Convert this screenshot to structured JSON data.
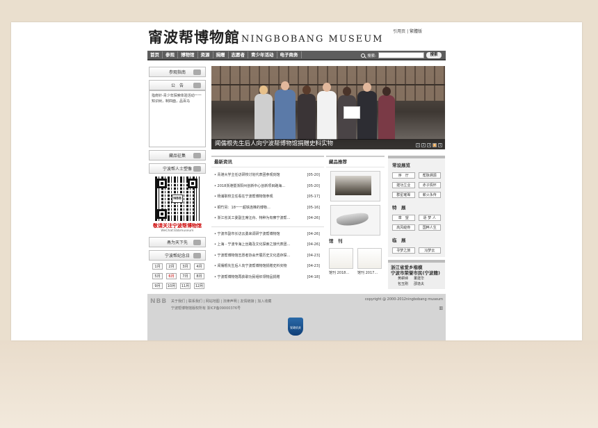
{
  "header": {
    "logo_cn": "甯波帮博物館",
    "logo_en": "NINGBOBANG  MUSEUM",
    "top_links": "引用页 | 繁體版"
  },
  "nav": {
    "items": [
      "首页",
      "参观",
      "博物馆",
      "资源",
      "捐赠",
      "志愿者",
      "青少年活动",
      "电子商务"
    ],
    "search_label": "搜索:",
    "search_button": "搜索"
  },
  "left": {
    "visit_guide": "参观指南",
    "notice_title": "公　告",
    "notice_text": "指南针-青少年探索体验活动一一知识树，制四面，品百马",
    "collect": "藏品征集",
    "portrait": "宁波帮人士塑像",
    "follow": "敬请关注宁波帮博物馆",
    "follow_en": "WeChat:Ebbmuseum",
    "qr_mid": "NBB",
    "world": "甬为天下先",
    "memorial": "宁波帮纪念日",
    "months": [
      "1月",
      "2月",
      "3月",
      "4月",
      "5月",
      "6月",
      "7月",
      "8月",
      "9月",
      "10月",
      "11月",
      "12月"
    ],
    "current_month": "6月"
  },
  "banner": {
    "caption": "闻儒根先生后人向宁波帮博物馆捐赠史料实物",
    "dots": [
      "1",
      "2",
      "3",
      "4",
      "5"
    ]
  },
  "news": {
    "title": "最新资讯",
    "group1": [
      {
        "t": "青港大学主任访研校讨划代表团参观刻馆",
        "d": "[05-20]"
      },
      {
        "t": "2018浙港暨浙阳州创新中心创新项目路海…",
        "d": "[05-20]"
      },
      {
        "t": "杨浦职校主任看在宁波帮博物馆参观",
        "d": "[05-17]"
      },
      {
        "t": "铜竹另：18一一超铁连推的博物…",
        "d": "[05-16]"
      },
      {
        "t": "浙江省关工委副主席汪舟、特种为有察宁波帮…",
        "d": "[04-26]"
      }
    ],
    "group2": [
      {
        "t": "宁波市副市长访云勇来调研宁波帮博物馆",
        "d": "[04-26]"
      },
      {
        "t": "上海 - 宁波专海上丝路及文化探索之旅代表团…",
        "d": "[04-26]"
      },
      {
        "t": "宁波帮博物馆志愿者协会开展历史文化遗存探…",
        "d": "[04-23]"
      },
      {
        "t": "闻儒根先生后人向宁波帮博物馆捐赠史料实物",
        "d": "[04-23]"
      },
      {
        "t": "宁波帮博物馆再获歌功民组织领物品捐赠",
        "d": "[04-18]"
      }
    ]
  },
  "collection": {
    "title": "藏品推荐",
    "journal_title": "馆　刊",
    "journals": [
      "馆刊 2018…",
      "馆刊 2017…"
    ]
  },
  "right": {
    "exhibit_title": "常设展览",
    "exhibits": [
      "序　厅",
      "帮脉溯源",
      "建功立业",
      "赤子情怀",
      "群星璀璨",
      "薪火永传"
    ],
    "special_title": "特　展",
    "specials": [
      "章　望",
      "逐 梦 人",
      "高风峻骨",
      "国粹人生"
    ],
    "temp_title": "临　展",
    "temps": [
      "寻梦之旅",
      "冯梦云"
    ],
    "tag_line1": "浙江省爱乡楷模",
    "tag_line2": "宁波市荣誉市民",
    "tag_paren": "(宁波籍)",
    "tag_sub": [
      "黄耕婶",
      "董建华",
      "包玉刚",
      "邵逸夫"
    ]
  },
  "footer": {
    "logo": "NBB",
    "links": "关于我们 | 联系我们 | 网站地图 | 法律声明 | 友情链接 | 加入收藏",
    "copy": "宁波帮博物馆版权所有  浙ICP备09000376号",
    "copyright": "copyright @ 2000-2012ningbobang museum",
    "badge": "党政机关"
  }
}
